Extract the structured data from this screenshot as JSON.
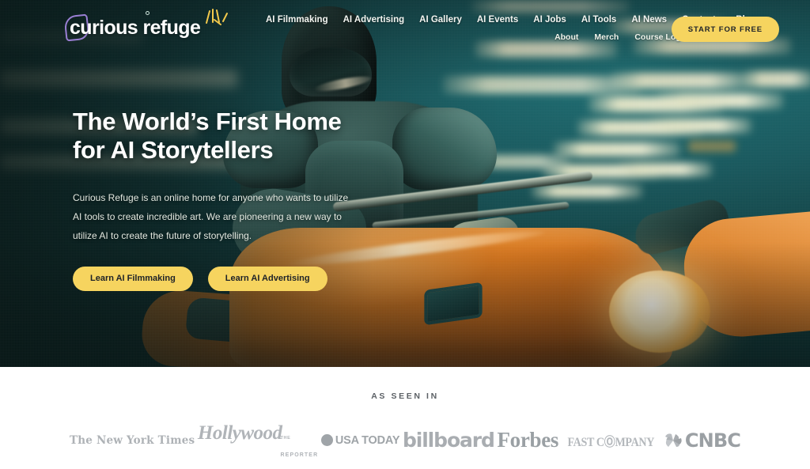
{
  "brand": {
    "logo_text": "curious refuge",
    "logo_accent_color": "#9a7fd4",
    "sparkle_color": "#f2c94c",
    "accent_yellow": "#f6d45f"
  },
  "header": {
    "primary_nav": [
      {
        "label": "AI Filmmaking"
      },
      {
        "label": "AI Advertising"
      },
      {
        "label": "AI Gallery"
      },
      {
        "label": "AI Events"
      },
      {
        "label": "AI Jobs"
      },
      {
        "label": "AI Tools"
      },
      {
        "label": "AI News"
      },
      {
        "label": "Contests"
      },
      {
        "label": "Blog"
      }
    ],
    "secondary_nav": [
      {
        "label": "About"
      },
      {
        "label": "Merch"
      },
      {
        "label": "Course Login"
      }
    ],
    "cta_label": "START FOR FREE"
  },
  "hero": {
    "title_line1": "The World’s First Home",
    "title_line2": "for AI Storytellers",
    "paragraph": "Curious Refuge is an online home for anyone who wants to utilize AI tools to create incredible art. We are pioneering a new way to utilize AI to create the future of storytelling.",
    "buttons": [
      {
        "label": "Learn AI Filmmaking"
      },
      {
        "label": "Learn AI Advertising"
      }
    ],
    "background_description": "Futuristic armored rider on an orange motorcycle under blurred ceiling lights, teal color grade"
  },
  "as_seen_in": {
    "label": "AS SEEN IN",
    "logos": [
      {
        "name": "the-new-york-times",
        "text": "The New York Times"
      },
      {
        "name": "the-hollywood-reporter",
        "text": "Hollywood",
        "kicker": "THE",
        "sub": "REPORTER"
      },
      {
        "name": "usa-today",
        "text": "USA TODAY"
      },
      {
        "name": "billboard",
        "text": "billboard"
      },
      {
        "name": "forbes",
        "text": "Forbes"
      },
      {
        "name": "fast-company",
        "text": "FAST CⓄMPANY"
      },
      {
        "name": "cnbc",
        "text": "CNBC"
      }
    ]
  }
}
